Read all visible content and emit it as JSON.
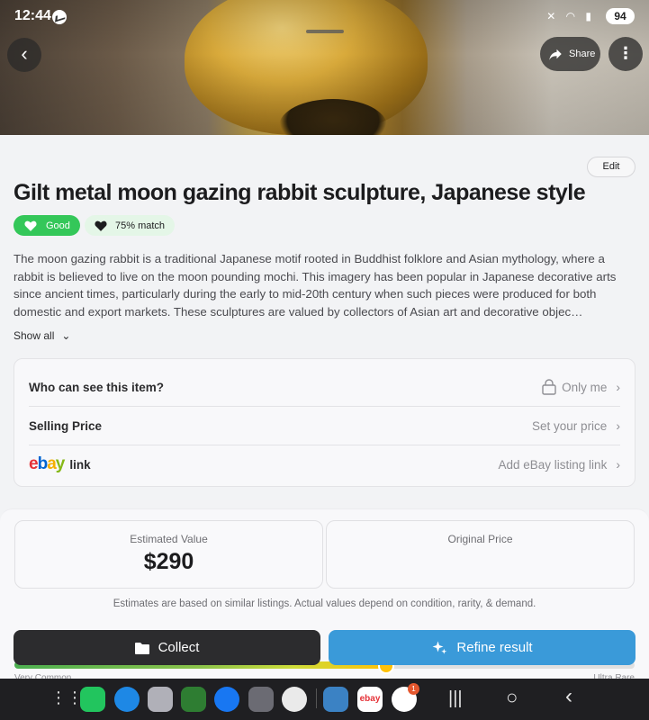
{
  "status_bar": {
    "time": "12:44",
    "battery": "94"
  },
  "header": {
    "share_label": "Share"
  },
  "item": {
    "edit_label": "Edit",
    "title": "Gilt metal moon gazing rabbit sculpture, Japanese style",
    "condition_badge": "Good",
    "match_badge": "75% match",
    "description": "The moon gazing rabbit is a traditional Japanese motif rooted in Buddhist folklore and Asian mythology, where a rabbit is believed to live on the moon pounding mochi. This imagery has been popular in Japanese decorative arts since ancient times, particularly during the early to mid-20th century when such pieces were produced for both domestic and export markets. These sculptures are valued by collectors of Asian art and decorative objec…",
    "show_all_label": "Show all"
  },
  "settings": {
    "visibility_label": "Who can see this item?",
    "visibility_value": "Only me",
    "price_label": "Selling Price",
    "price_value": "Set your price",
    "ebay_logo": "ebay",
    "ebay_label": "link",
    "ebay_value": "Add eBay listing link"
  },
  "valuation": {
    "estimated_label": "Estimated Value",
    "estimated_value": "$290",
    "original_label": "Original Price",
    "note": "Estimates are based on similar listings. Actual values depend on condition, rarity, & demand."
  },
  "rarity": {
    "low_label": "Very Common",
    "high_label": "Ultra Rare",
    "level": 0.6
  },
  "actions": {
    "collect_label": "Collect",
    "refine_label": "Refine result"
  },
  "taskbar": {
    "messenger_badge": "1",
    "ebay_app_label": "ebay"
  },
  "colors": {
    "good_green": "#34c759",
    "refine_blue": "#3a9ad9",
    "collect_dark": "#2c2c2e"
  }
}
